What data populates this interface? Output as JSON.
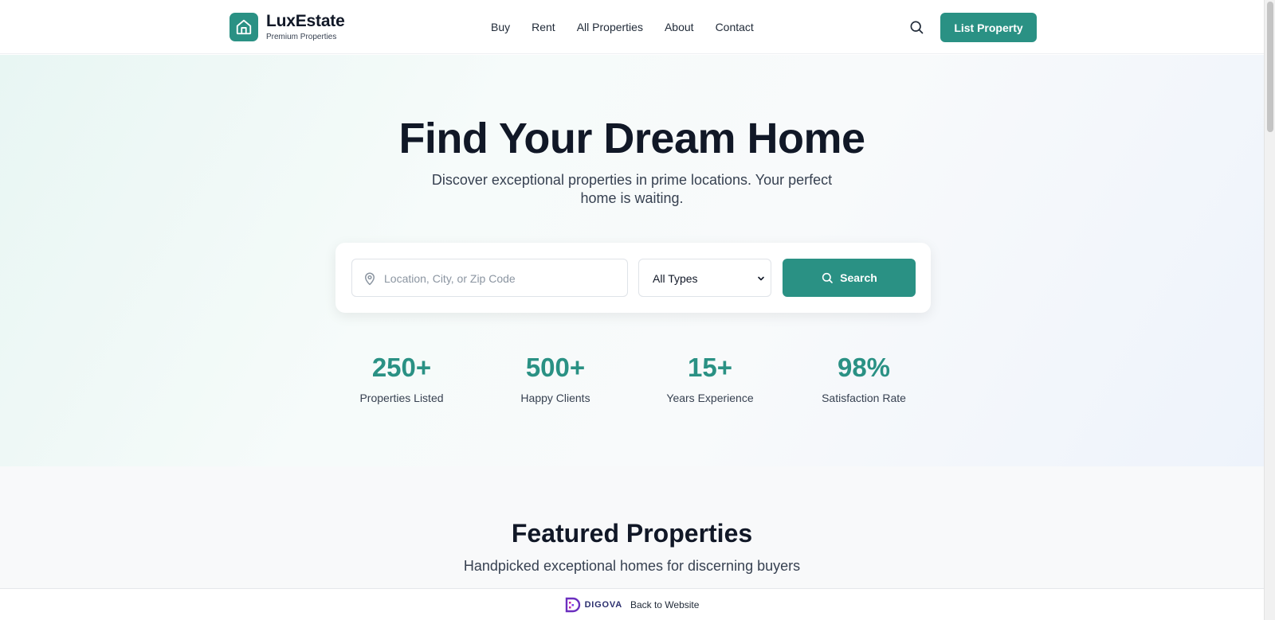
{
  "colors": {
    "accent": "#2a9184",
    "text": "#111827",
    "muted": "#374151"
  },
  "header": {
    "brand_name": "LuxEstate",
    "brand_tagline": "Premium Properties",
    "logo_icon": "house-icon",
    "nav": [
      "Buy",
      "Rent",
      "All Properties",
      "About",
      "Contact"
    ],
    "search_icon": "search-icon",
    "list_button": "List Property"
  },
  "hero": {
    "title": "Find Your Dream Home",
    "subtitle": "Discover exceptional properties in prime locations. Your perfect home is waiting.",
    "search": {
      "location_placeholder": "Location, City, or Zip Code",
      "location_value": "",
      "type_selected": "All Types",
      "button_label": "Search"
    },
    "stats": [
      {
        "value": "250+",
        "label": "Properties Listed"
      },
      {
        "value": "500+",
        "label": "Happy Clients"
      },
      {
        "value": "15+",
        "label": "Years Experience"
      },
      {
        "value": "98%",
        "label": "Satisfaction Rate"
      }
    ]
  },
  "featured": {
    "title": "Featured Properties",
    "subtitle": "Handpicked exceptional homes for discerning buyers"
  },
  "footer_bar": {
    "logo_text": "DIGOVA",
    "back_link": "Back to Website"
  }
}
